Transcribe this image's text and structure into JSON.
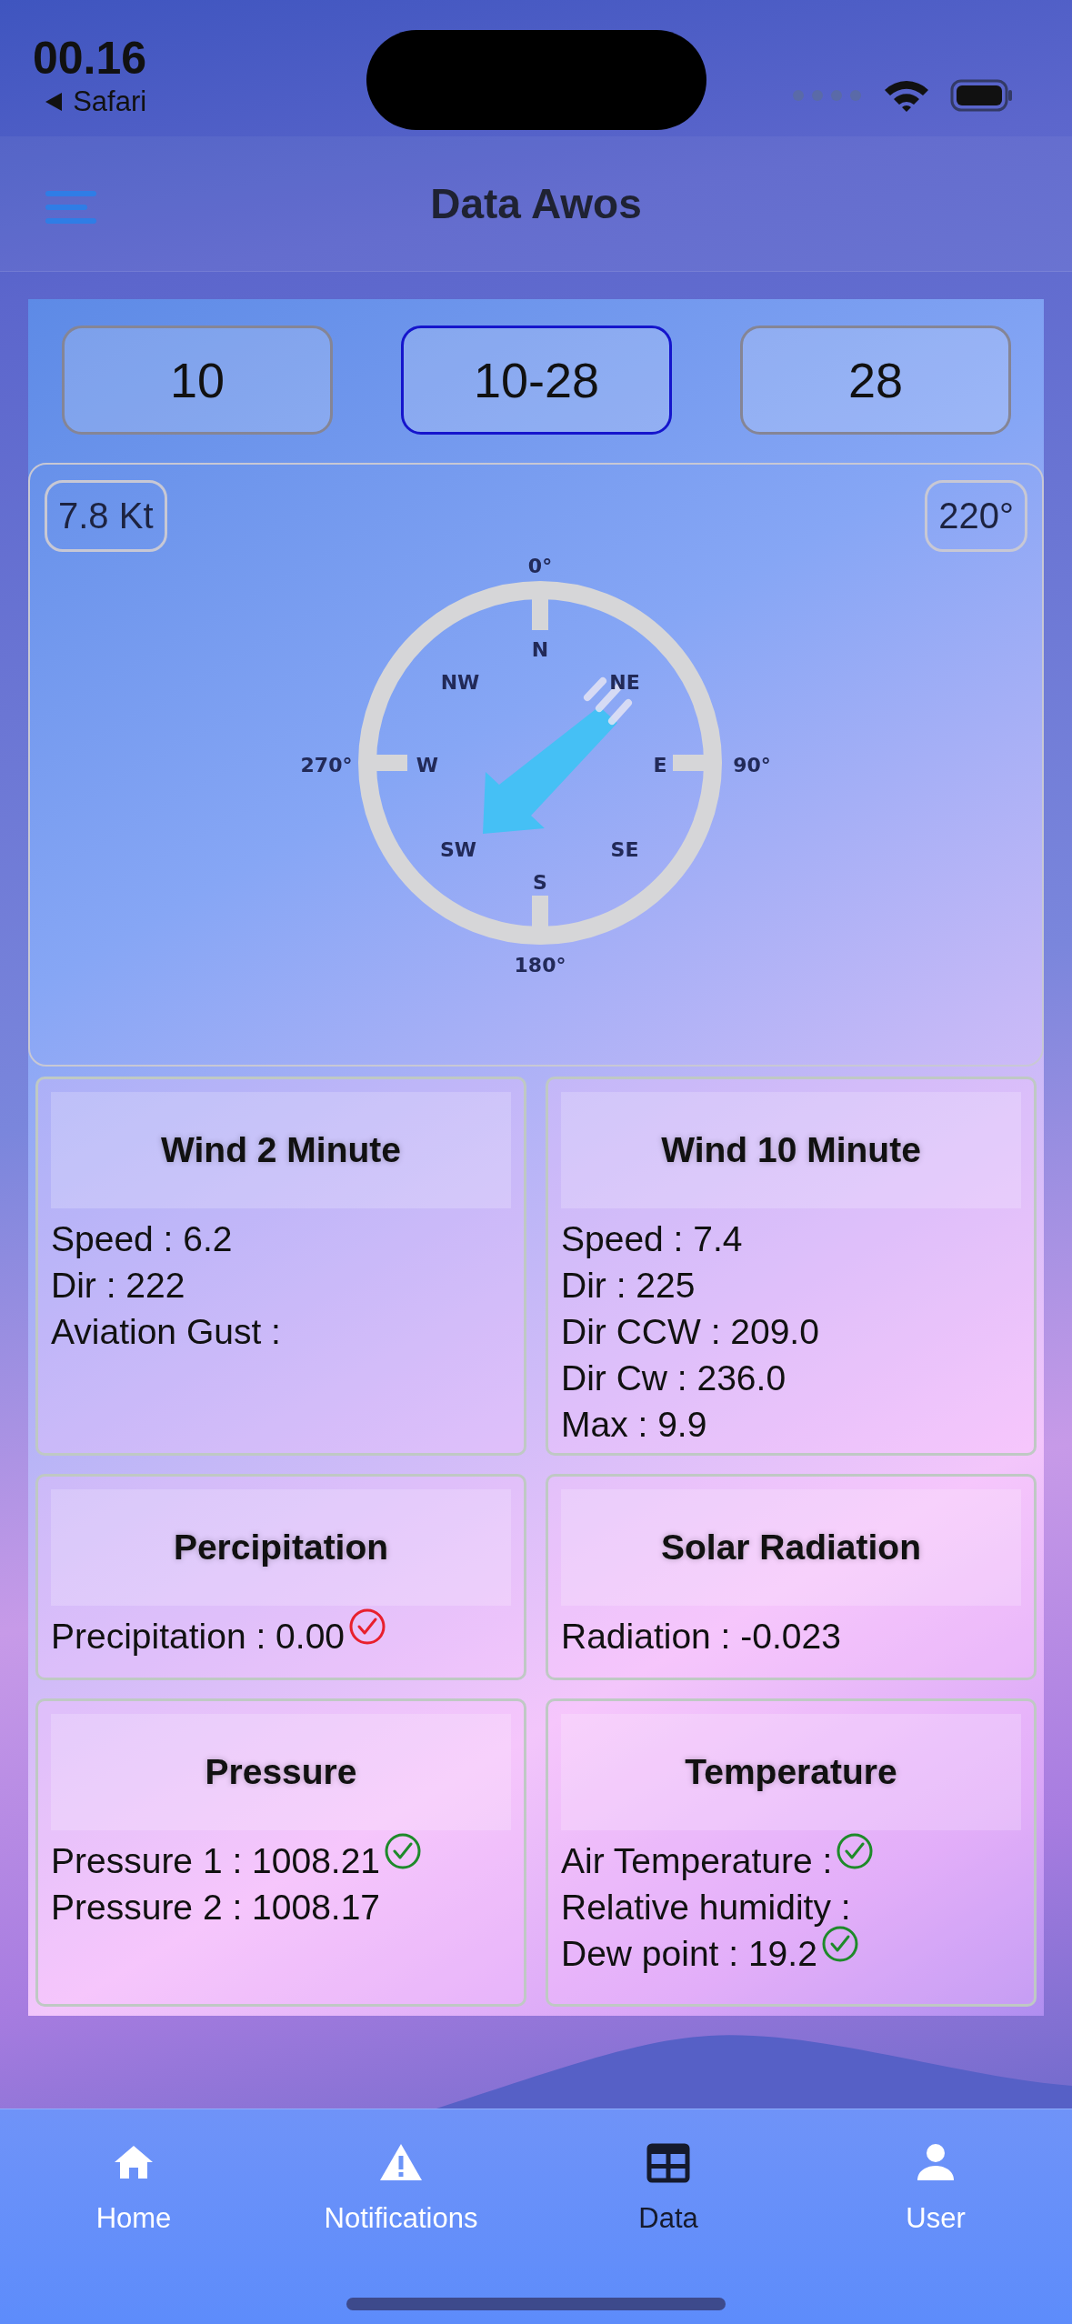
{
  "status_bar": {
    "time": "00.16",
    "back_label": "Safari"
  },
  "header": {
    "title": "Data Awos"
  },
  "runway_tabs": [
    {
      "label": "10",
      "selected": false
    },
    {
      "label": "10-28",
      "selected": true
    },
    {
      "label": "28",
      "selected": false
    }
  ],
  "wind_compass": {
    "speed": "7.8 Kt",
    "direction": "220°",
    "degree_labels": [
      "0°",
      "90°",
      "180°",
      "270°"
    ],
    "cardinal_labels": [
      "N",
      "NE",
      "E",
      "SE",
      "S",
      "SW",
      "W",
      "NW"
    ]
  },
  "cards": [
    {
      "title": "Wind 2 Minute",
      "lines": [
        {
          "text": "Speed : 6.2",
          "check": false
        },
        {
          "text": "Dir : 222",
          "check": false
        },
        {
          "text": "Aviation Gust :",
          "check": false
        }
      ]
    },
    {
      "title": "Wind 10 Minute",
      "lines": [
        {
          "text": "Speed : 7.4",
          "check": false
        },
        {
          "text": "Dir : 225",
          "check": false
        },
        {
          "text": "Dir CCW : 209.0",
          "check": false
        },
        {
          "text": "Dir Cw : 236.0",
          "check": false
        },
        {
          "text": "Max : 9.9",
          "check": false
        }
      ]
    },
    {
      "title": "Percipitation",
      "lines": [
        {
          "text": "Precipitation : 0.00",
          "check": true,
          "color": "#e8202c"
        }
      ]
    },
    {
      "title": "Solar Radiation",
      "lines": [
        {
          "text": "Radiation : -0.023",
          "check": false
        }
      ]
    },
    {
      "title": "Pressure",
      "lines": [
        {
          "text": "Pressure 1 : 1008.21",
          "check": true,
          "color": "#1e8a2a"
        },
        {
          "text": "Pressure 2 : 1008.17",
          "check": false
        }
      ]
    },
    {
      "title": "Temperature",
      "lines": [
        {
          "text": "Air Temperature :",
          "check": true,
          "color": "#1e8a2a"
        },
        {
          "text": "Relative humidity :",
          "check": false
        },
        {
          "text": "Dew point : 19.2",
          "check": true,
          "color": "#1e8a2a"
        }
      ]
    }
  ],
  "bottom_nav": [
    {
      "label": "Home",
      "kind": "home",
      "selected": false
    },
    {
      "label": "Notifications",
      "kind": "warning",
      "selected": false
    },
    {
      "label": "Data",
      "kind": "table",
      "selected": true
    },
    {
      "label": "User",
      "kind": "user",
      "selected": false
    }
  ]
}
